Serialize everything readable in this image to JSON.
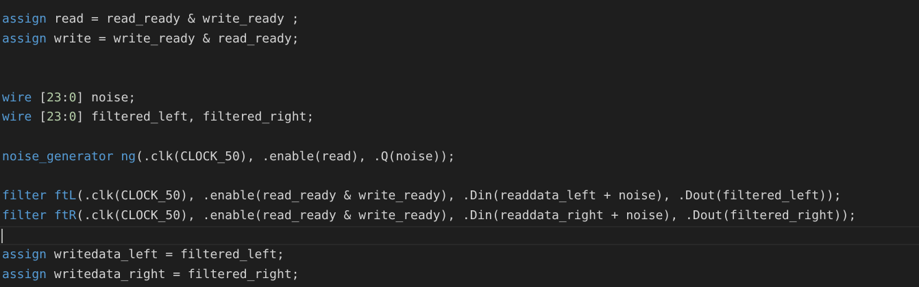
{
  "editor": {
    "language": "Verilog",
    "theme": {
      "background": "#1e1e1e",
      "keyword": "#569cd6",
      "number": "#b5cea8",
      "text": "#d4d4d4",
      "module": "#4ec9b0"
    },
    "current_line": 12,
    "lines": [
      [
        [
          "kw",
          "assign"
        ],
        [
          "id",
          " read = read_ready & write_ready ;"
        ]
      ],
      [
        [
          "kw",
          "assign"
        ],
        [
          "id",
          " write = write_ready & read_ready;"
        ]
      ],
      [],
      [],
      [
        [
          "kw",
          "wire"
        ],
        [
          "id",
          " ["
        ],
        [
          "num",
          "23"
        ],
        [
          "id",
          ":"
        ],
        [
          "num",
          "0"
        ],
        [
          "id",
          "] noise;"
        ]
      ],
      [
        [
          "kw",
          "wire"
        ],
        [
          "id",
          " ["
        ],
        [
          "num",
          "23"
        ],
        [
          "id",
          ":"
        ],
        [
          "num",
          "0"
        ],
        [
          "id",
          "] filtered_left, filtered_right;"
        ]
      ],
      [],
      [
        [
          "kw",
          "noise_generator"
        ],
        [
          "id",
          " "
        ],
        [
          "kw",
          "ng"
        ],
        [
          "id",
          "(.clk(CLOCK_50), .enable(read), .Q(noise));"
        ]
      ],
      [],
      [
        [
          "kw",
          "filter"
        ],
        [
          "id",
          " "
        ],
        [
          "kw",
          "ftL"
        ],
        [
          "id",
          "(.clk(CLOCK_50), .enable(read_ready & write_ready), .Din(readdata_left + noise), .Dout(filtered_left));"
        ]
      ],
      [
        [
          "kw",
          "filter"
        ],
        [
          "id",
          " "
        ],
        [
          "kw",
          "ftR"
        ],
        [
          "id",
          "(.clk(CLOCK_50), .enable(read_ready & write_ready), .Din(readdata_right + noise), .Dout(filtered_right));"
        ]
      ],
      [],
      [
        [
          "kw",
          "assign"
        ],
        [
          "id",
          " writedata_left = filtered_left;"
        ]
      ],
      [
        [
          "kw",
          "assign"
        ],
        [
          "id",
          " writedata_right = filtered_right;"
        ]
      ]
    ]
  }
}
